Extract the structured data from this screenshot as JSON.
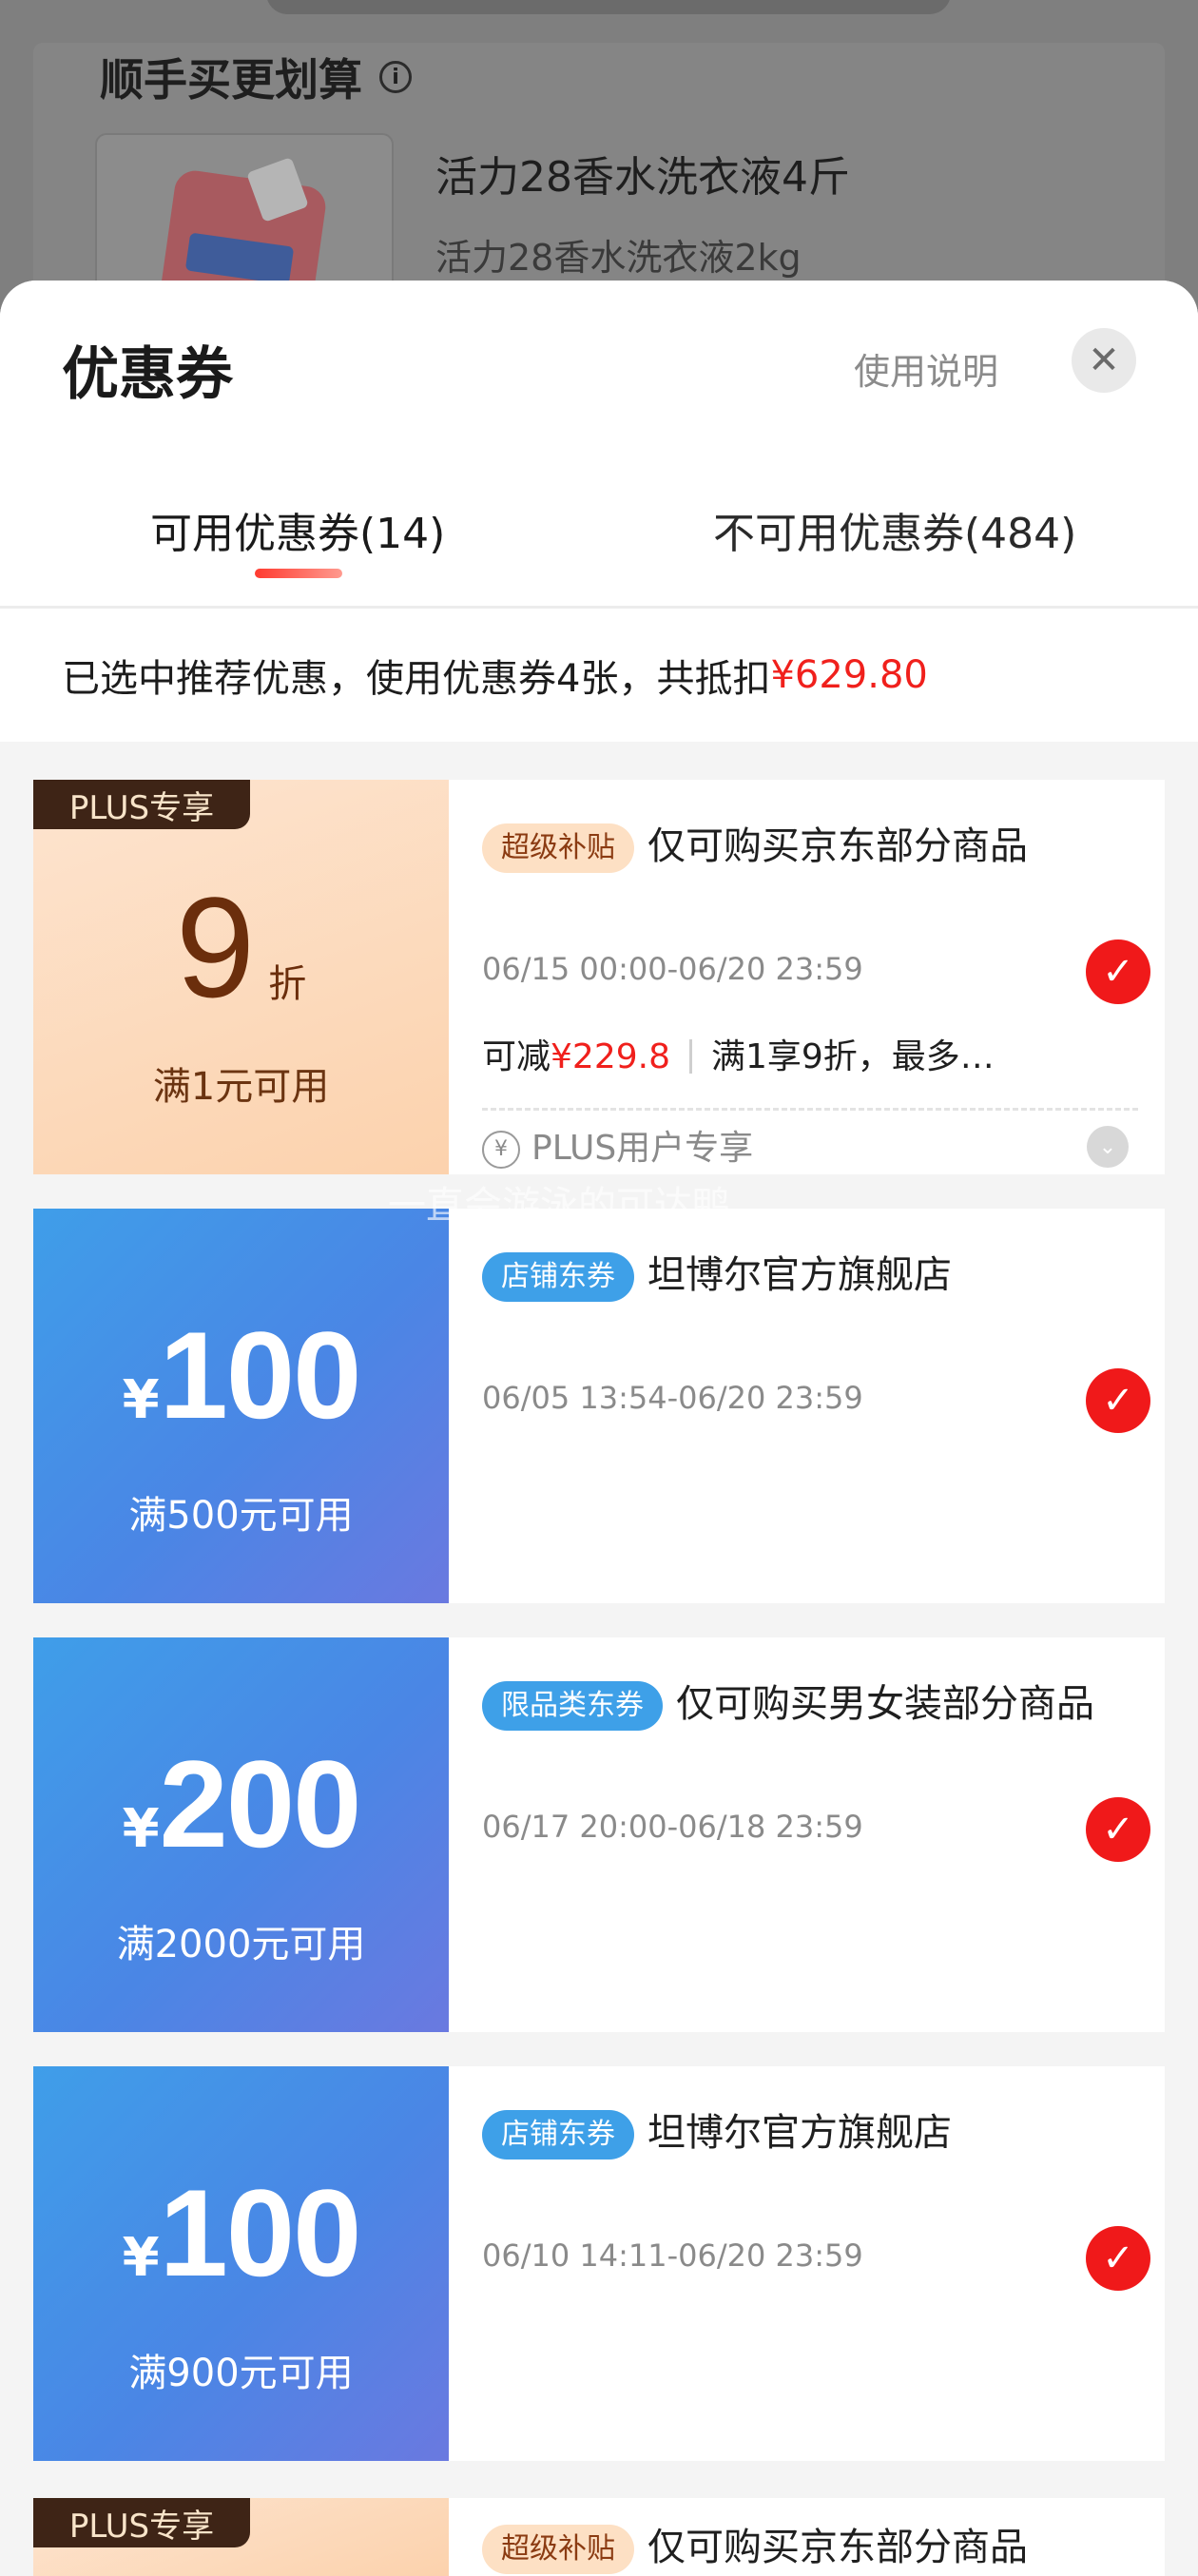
{
  "background": {
    "section_title": "顺手买更划算",
    "info_icon": "info-icon",
    "product_name": "活力28香水洗衣液4斤",
    "product_spec": "活力28香水洗衣液2kg"
  },
  "sheet": {
    "title": "优惠券",
    "help_label": "使用说明",
    "close_icon": "close-icon",
    "tabs": [
      {
        "label": "可用优惠券(14)",
        "active": true
      },
      {
        "label": "不可用优惠券(484)",
        "active": false
      }
    ],
    "summary": {
      "prefix": "已选中推荐优惠，使用优惠券4张，共抵扣",
      "amount": "¥629.80"
    }
  },
  "colors": {
    "accent_red": "#f0201c",
    "coupon_blue": "#4a86e5",
    "plus_peach": "#fcd2ad"
  },
  "watermark": "一直会游泳的可达鸭",
  "coupons": [
    {
      "type": "plus",
      "badge": "PLUS专享",
      "discount": "9",
      "discount_unit": "折",
      "condition": "满1元可用",
      "tag": "超级补贴",
      "title": "仅可购买京东部分商品",
      "date": "06/15 00:00-06/20 23:59",
      "saving_prefix": "可减",
      "saving_amount": "¥229.8",
      "saving_note": "满1享9折，最多…",
      "footer": "PLUS用户专享",
      "selected": true
    },
    {
      "type": "blue",
      "currency": "¥",
      "amount": "100",
      "condition": "满500元可用",
      "tag": "店铺东券",
      "title": "坦博尔官方旗舰店",
      "date": "06/05 13:54-06/20 23:59",
      "selected": true
    },
    {
      "type": "blue",
      "currency": "¥",
      "amount": "200",
      "condition": "满2000元可用",
      "tag": "限品类东券",
      "title": "仅可购买男女装部分商品",
      "date": "06/17 20:00-06/18 23:59",
      "selected": true
    },
    {
      "type": "blue",
      "currency": "¥",
      "amount": "100",
      "condition": "满900元可用",
      "tag": "店铺东券",
      "title": "坦博尔官方旗舰店",
      "date": "06/10 14:11-06/20 23:59",
      "selected": true
    },
    {
      "type": "plus",
      "badge": "PLUS专享",
      "tag": "超级补贴",
      "title": "仅可购买京东部分商品"
    }
  ]
}
